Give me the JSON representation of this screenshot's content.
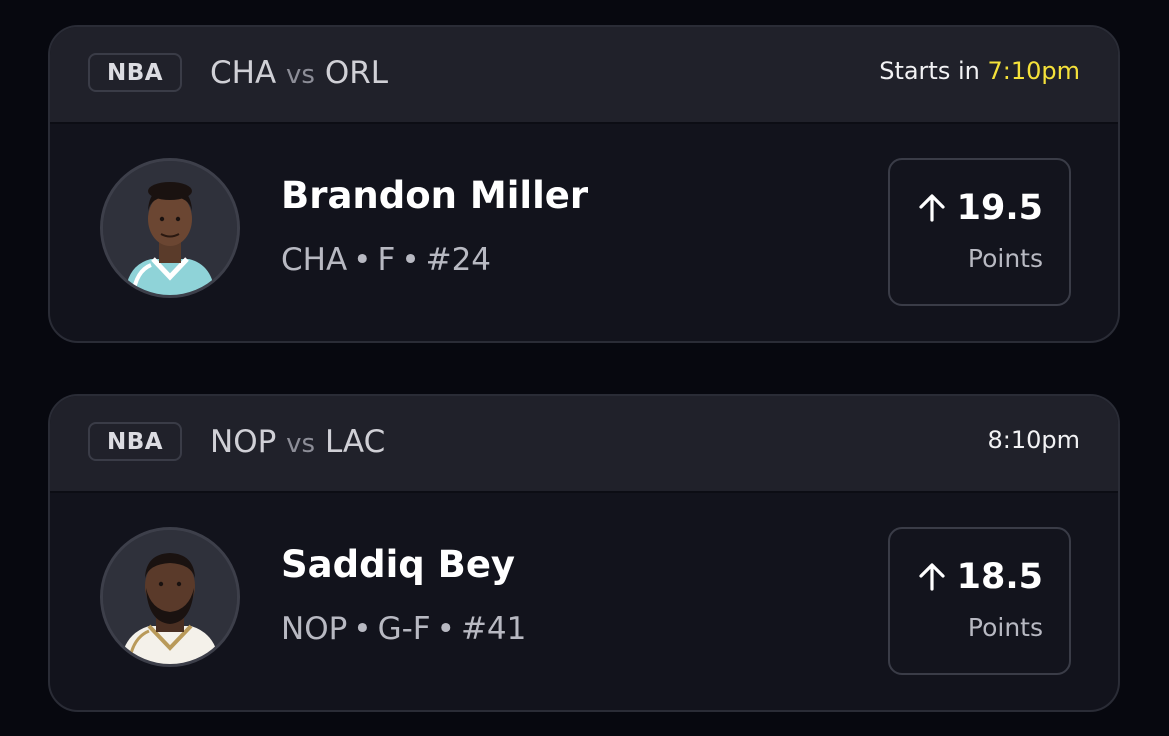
{
  "projections": [
    {
      "league": "NBA",
      "matchup": {
        "home": "CHA",
        "vs": "vs",
        "away": "ORL"
      },
      "start": {
        "prefix": "Starts in",
        "time": "7:10pm"
      },
      "player": {
        "name": "Brandon Miller",
        "team": "CHA",
        "position": "F",
        "number": "#24",
        "separator": "•",
        "avatar_icon": "player-headshot-icon"
      },
      "prop": {
        "direction_icon": "arrow-up-icon",
        "line": "19.5",
        "stat": "Points"
      }
    },
    {
      "league": "NBA",
      "matchup": {
        "home": "NOP",
        "vs": "vs",
        "away": "LAC"
      },
      "start": {
        "prefix": "",
        "time": "8:10pm"
      },
      "player": {
        "name": "Saddiq Bey",
        "team": "NOP",
        "position": "G-F",
        "number": "#41",
        "separator": "•",
        "avatar_icon": "player-headshot-icon"
      },
      "prop": {
        "direction_icon": "arrow-up-icon",
        "line": "18.5",
        "stat": "Points"
      }
    }
  ],
  "colors": {
    "background": "#07080f",
    "card": "#12131c",
    "header": "#20212a",
    "accent_time": "#f5e13a",
    "jersey_cha": "#8fd3d8",
    "jersey_nop": "#f4f1ea"
  }
}
